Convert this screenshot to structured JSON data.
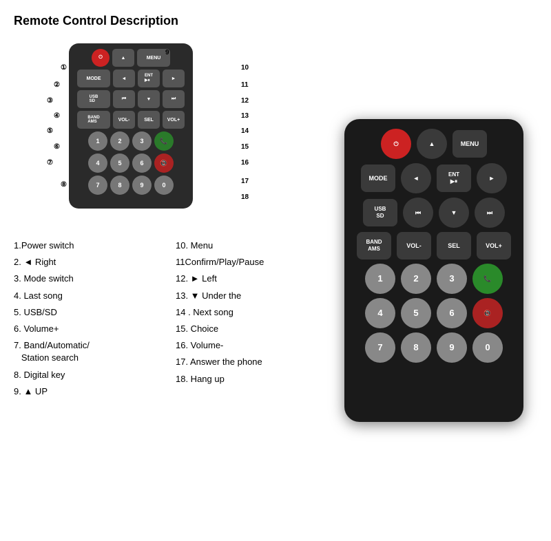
{
  "title": "Remote Control Description",
  "diagram": {
    "callouts": [
      {
        "num": "①",
        "label": "Power switch"
      },
      {
        "num": "②",
        "label": "◄ Right"
      },
      {
        "num": "③",
        "label": "Mode switch"
      },
      {
        "num": "④",
        "label": "Last song"
      },
      {
        "num": "⑤",
        "label": "USB/SD"
      },
      {
        "num": "⑥",
        "label": "Volume+"
      },
      {
        "num": "⑦",
        "label": "Band/Automatic/Station search"
      },
      {
        "num": "⑧",
        "label": "Digital key"
      },
      {
        "num": "⑨",
        "label": "▲ UP"
      },
      {
        "num": "⑩",
        "label": "Menu"
      },
      {
        "num": "11",
        "label": "Confirm/Play/Pause"
      },
      {
        "num": "12.",
        "label": "► Left"
      },
      {
        "num": "13.",
        "label": "▼ Under the"
      },
      {
        "num": "14.",
        "label": "Next song"
      },
      {
        "num": "15.",
        "label": "Choice"
      },
      {
        "num": "16.",
        "label": "Volume-"
      },
      {
        "num": "17.",
        "label": "Answer the phone"
      },
      {
        "num": "18.",
        "label": "Hang up"
      }
    ]
  },
  "desc_left": [
    {
      "num": "1.",
      "text": "Power switch"
    },
    {
      "num": "2.",
      "text": "◄ Right"
    },
    {
      "num": "3.",
      "text": "Mode switch"
    },
    {
      "num": "4.",
      "text": "Last song"
    },
    {
      "num": "5.",
      "text": "USB/SD"
    },
    {
      "num": "6.",
      "text": "Volume+"
    },
    {
      "num": "7.",
      "text": "Band/Automatic/  Station search"
    },
    {
      "num": "8.",
      "text": "Digital key"
    },
    {
      "num": "9.",
      "text": "▲ UP"
    }
  ],
  "desc_right": [
    {
      "num": "10.",
      "text": "Menu"
    },
    {
      "num": "11",
      "text": "Confirm/Play/Pause"
    },
    {
      "num": "12.",
      "text": "► Left"
    },
    {
      "num": "13.",
      "text": "▼ Under the"
    },
    {
      "num": "14.",
      "text": "Next song"
    },
    {
      "num": "15.",
      "text": "Choice"
    },
    {
      "num": "16.",
      "text": "Volume-"
    },
    {
      "num": "17.",
      "text": "Answer the phone"
    },
    {
      "num": "18.",
      "text": "Hang up"
    }
  ],
  "remote_rows": [
    [
      {
        "label": "⏻",
        "type": "power"
      },
      {
        "label": "▲",
        "type": "round"
      },
      {
        "label": "MENU",
        "type": "normal"
      }
    ],
    [
      {
        "label": "MODE",
        "type": "normal"
      },
      {
        "label": "◄",
        "type": "round"
      },
      {
        "label": "ENT\n▶⏸",
        "type": "normal"
      },
      {
        "label": "►",
        "type": "round"
      }
    ],
    [
      {
        "label": "USB\nSD",
        "type": "normal"
      },
      {
        "label": "⏮",
        "type": "round"
      },
      {
        "label": "▼",
        "type": "round"
      },
      {
        "label": "⏭",
        "type": "round"
      }
    ],
    [
      {
        "label": "BAND\nAMS",
        "type": "normal"
      },
      {
        "label": "VOL-",
        "type": "normal"
      },
      {
        "label": "SEL",
        "type": "normal"
      },
      {
        "label": "VOL+",
        "type": "normal"
      }
    ],
    [
      {
        "label": "1",
        "type": "num"
      },
      {
        "label": "2",
        "type": "num"
      },
      {
        "label": "3",
        "type": "num"
      },
      {
        "label": "📞",
        "type": "green"
      }
    ],
    [
      {
        "label": "4",
        "type": "num"
      },
      {
        "label": "5",
        "type": "num"
      },
      {
        "label": "6",
        "type": "num"
      },
      {
        "label": "📵",
        "type": "red"
      }
    ],
    [
      {
        "label": "7",
        "type": "num"
      },
      {
        "label": "8",
        "type": "num"
      },
      {
        "label": "9",
        "type": "num"
      },
      {
        "label": "0",
        "type": "num"
      }
    ]
  ]
}
